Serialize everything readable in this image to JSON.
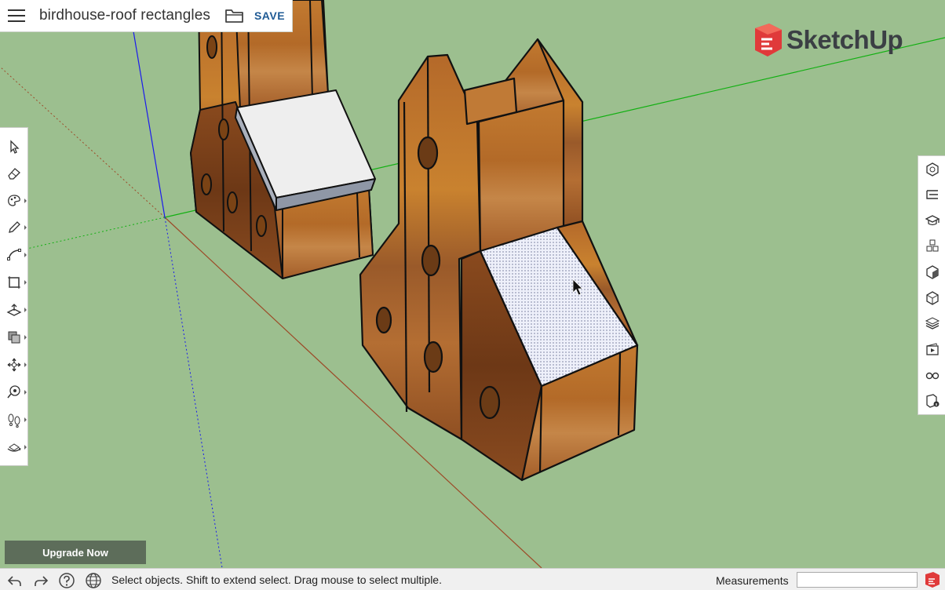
{
  "file": {
    "title": "birdhouse-roof rectangles",
    "save_label": "SAVE"
  },
  "brand": {
    "name": "SketchUp",
    "color": "#e03a3a"
  },
  "left_toolbar": {
    "tools": [
      {
        "name": "select-tool",
        "icon": "arrow-cursor-icon",
        "submenu": false
      },
      {
        "name": "eraser-tool",
        "icon": "eraser-icon",
        "submenu": false
      },
      {
        "name": "paint-bucket-tool",
        "icon": "paint-palette-icon",
        "submenu": true
      },
      {
        "name": "line-tool",
        "icon": "pencil-icon",
        "submenu": true
      },
      {
        "name": "arc-tool",
        "icon": "arc-icon",
        "submenu": true
      },
      {
        "name": "rectangle-tool",
        "icon": "rectangle-icon",
        "submenu": true
      },
      {
        "name": "push-pull-tool",
        "icon": "push-pull-icon",
        "submenu": true
      },
      {
        "name": "offset-tool",
        "icon": "offset-icon",
        "submenu": true
      },
      {
        "name": "move-tool",
        "icon": "move-icon",
        "submenu": true
      },
      {
        "name": "tape-measure-tool",
        "icon": "tape-measure-icon",
        "submenu": true
      },
      {
        "name": "walk-tool",
        "icon": "footprints-icon",
        "submenu": true
      },
      {
        "name": "orbit-tool",
        "icon": "orbit-icon",
        "submenu": true
      }
    ]
  },
  "right_toolbar": {
    "tools": [
      {
        "name": "entity-info",
        "icon": "entity-info-icon"
      },
      {
        "name": "outliner",
        "icon": "outliner-icon"
      },
      {
        "name": "instructor",
        "icon": "graduation-cap-icon"
      },
      {
        "name": "components",
        "icon": "components-icon"
      },
      {
        "name": "materials",
        "icon": "materials-cube-icon"
      },
      {
        "name": "styles",
        "icon": "styles-icon"
      },
      {
        "name": "layers",
        "icon": "layers-icon"
      },
      {
        "name": "scenes",
        "icon": "scenes-icon"
      },
      {
        "name": "display",
        "icon": "glasses-icon"
      },
      {
        "name": "model-info",
        "icon": "model-info-icon"
      }
    ]
  },
  "upgrade": {
    "label": "Upgrade Now"
  },
  "status": {
    "message": "Select objects. Shift to extend select. Drag mouse to select multiple.",
    "measurements_label": "Measurements",
    "measurements_value": ""
  },
  "colors": {
    "sky_ground": "#9cbf8f",
    "wood": "#b5712e",
    "selection": "#e9ecf6",
    "axis_red": "#a0522d",
    "axis_green": "#12b012",
    "axis_blue": "#1a1aff"
  }
}
